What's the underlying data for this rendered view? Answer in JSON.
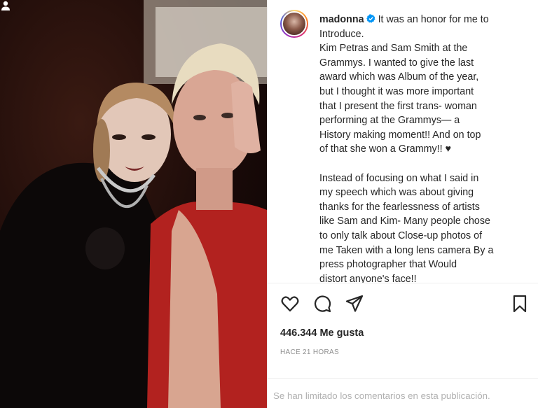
{
  "post": {
    "username": "madonna",
    "caption_first_line": "It was an honor for me to",
    "caption_lines_1": [
      "Introduce.",
      "Kim Petras and Sam Smith at the",
      "Grammys. I wanted to give the last",
      "award which was Album of the year,",
      "but I thought it was more important",
      "that I present the first trans- woman",
      "performing at the Grammys— a",
      "History making moment!! And on top",
      "of that she won a Grammy!! ♥"
    ],
    "caption_lines_2": [
      "Instead of focusing on what I said in",
      "my speech which was about giving",
      "thanks for the fearlessness of artists",
      "like Sam and Kim- Many people chose",
      "to only talk about Close-up photos of",
      "me Taken with a long lens camera By a",
      "press photographer that Would",
      "distort anyone's face!!"
    ],
    "likes": "446.344 Me gusta",
    "time": "HACE 21 HORAS",
    "comments_limited": "Se han limitado los comentarios en esta publicación."
  },
  "icons": {
    "verified": "verified-badge-icon",
    "like": "heart-icon",
    "comment": "comment-icon",
    "share": "share-icon",
    "save": "bookmark-icon",
    "tag": "user-tag-icon"
  },
  "colors": {
    "verified": "#0095f6",
    "text": "#262626",
    "muted": "#8e8e8e"
  }
}
